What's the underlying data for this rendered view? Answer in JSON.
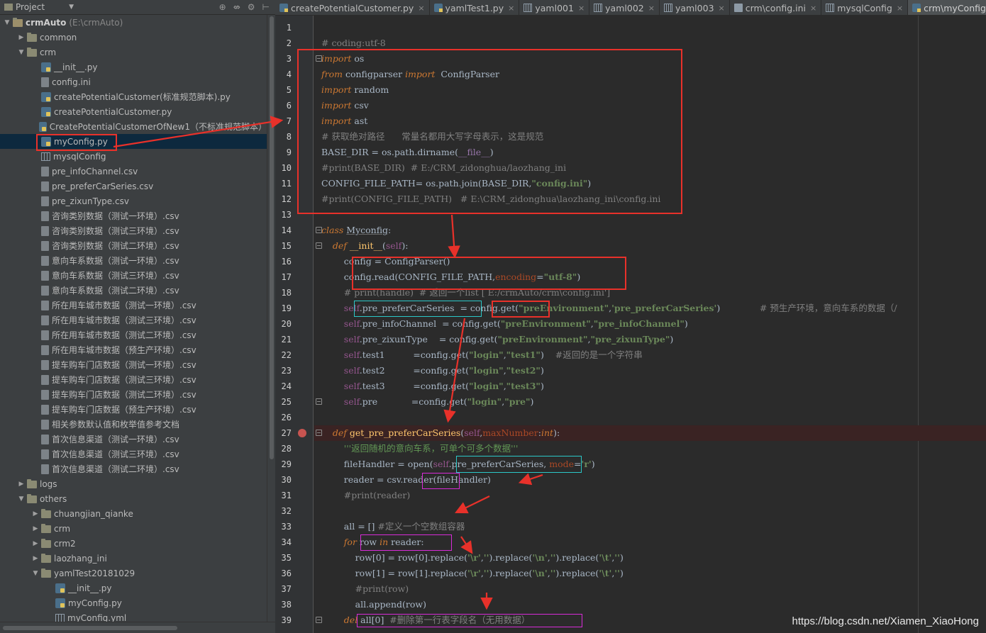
{
  "project_panel": {
    "title": "Project",
    "header_icons": [
      "globe-icon",
      "split-icon",
      "gear-icon",
      "collapse-icon"
    ]
  },
  "tree": [
    {
      "label": "crmAuto",
      "sub": "(E:\\crmAuto)",
      "icon": "folder",
      "arrow": "down",
      "depth": 0,
      "bold": true
    },
    {
      "label": "common",
      "icon": "folder",
      "arrow": "right",
      "depth": 1
    },
    {
      "label": "crm",
      "icon": "folder",
      "arrow": "down",
      "depth": 1
    },
    {
      "label": "__init__.py",
      "icon": "py",
      "depth": 2
    },
    {
      "label": "config.ini",
      "icon": "file",
      "depth": 2
    },
    {
      "label": "createPotentialCustomer(标准规范脚本).py",
      "icon": "py",
      "depth": 2
    },
    {
      "label": "createPotentialCustomer.py",
      "icon": "py",
      "depth": 2
    },
    {
      "label": "CreatePotentialCustomerOfNew1（不标准规范脚本）",
      "icon": "py",
      "depth": 2
    },
    {
      "label": "myConfig.py",
      "icon": "py",
      "depth": 2,
      "selected": true
    },
    {
      "label": "mysqlConfig",
      "icon": "grid",
      "depth": 2
    },
    {
      "label": "pre_infoChannel.csv",
      "icon": "file",
      "depth": 2
    },
    {
      "label": "pre_preferCarSeries.csv",
      "icon": "file",
      "depth": 2
    },
    {
      "label": "pre_zixunType.csv",
      "icon": "file",
      "depth": 2
    },
    {
      "label": "咨询类别数据（测试一环境）.csv",
      "icon": "file",
      "depth": 2
    },
    {
      "label": "咨询类别数据（测试三环境）.csv",
      "icon": "file",
      "depth": 2
    },
    {
      "label": "咨询类别数据（测试二环境）.csv",
      "icon": "file",
      "depth": 2
    },
    {
      "label": "意向车系数据（测试一环境）.csv",
      "icon": "file",
      "depth": 2
    },
    {
      "label": "意向车系数据（测试三环境）.csv",
      "icon": "file",
      "depth": 2
    },
    {
      "label": "意向车系数据（测试二环境）.csv",
      "icon": "file",
      "depth": 2
    },
    {
      "label": "所在用车城市数据（测试一环境）.csv",
      "icon": "file",
      "depth": 2
    },
    {
      "label": "所在用车城市数据（测试三环境）.csv",
      "icon": "file",
      "depth": 2
    },
    {
      "label": "所在用车城市数据（测试二环境）.csv",
      "icon": "file",
      "depth": 2
    },
    {
      "label": "所在用车城市数据（预生产环境）.csv",
      "icon": "file",
      "depth": 2
    },
    {
      "label": "提车购车门店数据（测试一环境）.csv",
      "icon": "file",
      "depth": 2
    },
    {
      "label": "提车购车门店数据（测试三环境）.csv",
      "icon": "file",
      "depth": 2
    },
    {
      "label": "提车购车门店数据（测试二环境）.csv",
      "icon": "file",
      "depth": 2
    },
    {
      "label": "提车购车门店数据（预生产环境）.csv",
      "icon": "file",
      "depth": 2
    },
    {
      "label": "相关参数默认值和枚举值参考文档",
      "icon": "file",
      "depth": 2
    },
    {
      "label": "首次信息渠道（测试一环境）.csv",
      "icon": "file",
      "depth": 2
    },
    {
      "label": "首次信息渠道（测试三环境）.csv",
      "icon": "file",
      "depth": 2
    },
    {
      "label": "首次信息渠道（测试二环境）.csv",
      "icon": "file",
      "depth": 2
    },
    {
      "label": "logs",
      "icon": "folder",
      "arrow": "right",
      "depth": 1
    },
    {
      "label": "others",
      "icon": "folder",
      "arrow": "down",
      "depth": 1
    },
    {
      "label": "chuangjian_qianke",
      "icon": "folder",
      "arrow": "right",
      "depth": 2
    },
    {
      "label": "crm",
      "icon": "folder",
      "arrow": "right",
      "depth": 2
    },
    {
      "label": "crm2",
      "icon": "folder",
      "arrow": "right",
      "depth": 2
    },
    {
      "label": "laozhang_ini",
      "icon": "folder",
      "arrow": "right",
      "depth": 2
    },
    {
      "label": "yamlTest20181029",
      "icon": "folder",
      "arrow": "down",
      "depth": 2
    },
    {
      "label": "__init__.py",
      "icon": "py",
      "depth": 3
    },
    {
      "label": "myConfig.py",
      "icon": "py",
      "depth": 3
    },
    {
      "label": "myConfig.yml",
      "icon": "grid",
      "depth": 3
    }
  ],
  "tabs": [
    {
      "label": "createPotentialCustomer.py",
      "icon": "py"
    },
    {
      "label": "yamlTest1.py",
      "icon": "py"
    },
    {
      "label": "yaml001",
      "icon": "grid"
    },
    {
      "label": "yaml002",
      "icon": "grid"
    },
    {
      "label": "yaml003",
      "icon": "grid"
    },
    {
      "label": "crm\\config.ini",
      "icon": "ini"
    },
    {
      "label": "mysqlConfig",
      "icon": "grid"
    },
    {
      "label": "crm\\myConfig.py",
      "icon": "py",
      "active": true
    }
  ],
  "code": [
    [],
    [
      [
        "cm",
        "# coding:utf-8"
      ]
    ],
    [
      [
        "kw",
        "import"
      ],
      [
        "t",
        " os"
      ]
    ],
    [
      [
        "kw",
        "from"
      ],
      [
        "t",
        " configparser "
      ],
      [
        "kw",
        "import"
      ],
      [
        "t",
        "  ConfigParser"
      ]
    ],
    [
      [
        "kw",
        "import"
      ],
      [
        "t",
        " random"
      ]
    ],
    [
      [
        "kw",
        "import"
      ],
      [
        "t",
        " csv"
      ]
    ],
    [
      [
        "kw",
        "import"
      ],
      [
        "t",
        " ast"
      ]
    ],
    [
      [
        "cm",
        "# 获取绝对路径      常量名都用大写字母表示，这是规范"
      ]
    ],
    [
      [
        "t",
        "BASE_DIR = os.path.dirname("
      ],
      [
        "cn",
        "__file__"
      ],
      [
        "t",
        ")"
      ]
    ],
    [
      [
        "cm",
        "#print(BASE_DIR)  # E:/CRM_zidonghua/laozhang_ini"
      ]
    ],
    [
      [
        "t",
        "CONFIG_FILE_PATH= os.path.join(BASE_DIR,"
      ],
      [
        "st",
        "\"config.ini\""
      ],
      [
        "t",
        ")"
      ]
    ],
    [
      [
        "cm",
        "#print(CONFIG_FILE_PATH)   # E:\\CRM_zidonghua\\laozhang_ini\\config.ini"
      ]
    ],
    [],
    [
      [
        "kw",
        "class "
      ],
      [
        "ul",
        "Myconfig"
      ],
      [
        "t",
        ":"
      ]
    ],
    [
      [
        "t",
        "    "
      ],
      [
        "kw",
        "def "
      ],
      [
        "fn",
        "__init__"
      ],
      [
        "t",
        "("
      ],
      [
        "sf",
        "self"
      ],
      [
        "t",
        "):"
      ]
    ],
    [
      [
        "t",
        "        config = ConfigParser()"
      ]
    ],
    [
      [
        "t",
        "        config.read(CONFIG_FILE_PATH,"
      ],
      [
        "pr",
        "encoding"
      ],
      [
        "t",
        "="
      ],
      [
        "st",
        "\"utf-8\""
      ],
      [
        "t",
        ")"
      ]
    ],
    [
      [
        "cm",
        "        # print(handle)  # 返回一个list [ E:/crmAuto/crm\\config.ini']"
      ]
    ],
    [
      [
        "t",
        "        "
      ],
      [
        "sf",
        "self"
      ],
      [
        "t",
        ".pre_preferCarSeries  = config.get("
      ],
      [
        "st",
        "\"preEnvironment\""
      ],
      [
        "t",
        ","
      ],
      [
        "st",
        "'pre_preferCarSeries'"
      ],
      [
        "t",
        ")"
      ],
      [
        "cm",
        "              # 预生产环境，意向车系的数据（/"
      ]
    ],
    [
      [
        "t",
        "        "
      ],
      [
        "sf",
        "self"
      ],
      [
        "t",
        ".pre_infoChannel  = config.get("
      ],
      [
        "st",
        "\"preEnvironment\""
      ],
      [
        "t",
        ","
      ],
      [
        "st",
        "\"pre_infoChannel\""
      ],
      [
        "t",
        ")"
      ]
    ],
    [
      [
        "t",
        "        "
      ],
      [
        "sf",
        "self"
      ],
      [
        "t",
        ".pre_zixunType    = config.get("
      ],
      [
        "st",
        "\"preEnvironment\""
      ],
      [
        "t",
        ","
      ],
      [
        "st",
        "\"pre_zixunType\""
      ],
      [
        "t",
        ")"
      ]
    ],
    [
      [
        "t",
        "        "
      ],
      [
        "sf",
        "self"
      ],
      [
        "t",
        ".test1          =config.get("
      ],
      [
        "st",
        "\"login\""
      ],
      [
        "t",
        ","
      ],
      [
        "st",
        "\"test1\""
      ],
      [
        "t",
        ")    "
      ],
      [
        "cm",
        "#返回的是一个字符串"
      ]
    ],
    [
      [
        "t",
        "        "
      ],
      [
        "sf",
        "self"
      ],
      [
        "t",
        ".test2          =config.get("
      ],
      [
        "st",
        "\"login\""
      ],
      [
        "t",
        ","
      ],
      [
        "st",
        "\"test2\""
      ],
      [
        "t",
        ")"
      ]
    ],
    [
      [
        "t",
        "        "
      ],
      [
        "sf",
        "self"
      ],
      [
        "t",
        ".test3          =config.get("
      ],
      [
        "st",
        "\"login\""
      ],
      [
        "t",
        ","
      ],
      [
        "st",
        "\"test3\""
      ],
      [
        "t",
        ")"
      ]
    ],
    [
      [
        "t",
        "        "
      ],
      [
        "sf",
        "self"
      ],
      [
        "t",
        ".pre            =config.get("
      ],
      [
        "st",
        "\"login\""
      ],
      [
        "t",
        ","
      ],
      [
        "st",
        "\"pre\""
      ],
      [
        "t",
        ")"
      ]
    ],
    [],
    [
      [
        "t",
        "    "
      ],
      [
        "kw",
        "def "
      ],
      [
        "fn",
        "get_pre_preferCarSeries"
      ],
      [
        "t",
        "("
      ],
      [
        "sf",
        "self"
      ],
      [
        "t",
        ","
      ],
      [
        "pr",
        "maxNumber"
      ],
      [
        "t",
        ":"
      ],
      [
        "kw",
        "int"
      ],
      [
        "t",
        "):"
      ]
    ],
    [
      [
        "dc",
        "        '''返回随机的意向车系，可单个可多个数据'''"
      ]
    ],
    [
      [
        "t",
        "        fileHandler = open("
      ],
      [
        "sf",
        "self"
      ],
      [
        "t",
        ".pre_preferCarSeries, "
      ],
      [
        "pr",
        "mode"
      ],
      [
        "t",
        "="
      ],
      [
        "st",
        "'r'"
      ],
      [
        "t",
        ")"
      ]
    ],
    [
      [
        "t",
        "        reader = csv.reader(fileHandler)"
      ]
    ],
    [
      [
        "cm",
        "        #print(reader)"
      ]
    ],
    [],
    [
      [
        "t",
        "        all = [] "
      ],
      [
        "cm",
        "#定义一个空数组容器"
      ]
    ],
    [
      [
        "t",
        "        "
      ],
      [
        "kw",
        "for"
      ],
      [
        "t",
        " row "
      ],
      [
        "kw",
        "in"
      ],
      [
        "t",
        " reader:"
      ]
    ],
    [
      [
        "t",
        "            row[0] = row[0].replace("
      ],
      [
        "st",
        "'\\r'"
      ],
      [
        "t",
        ","
      ],
      [
        "st",
        "''"
      ],
      [
        "t",
        ").replace("
      ],
      [
        "st",
        "'\\n'"
      ],
      [
        "t",
        ","
      ],
      [
        "st",
        "''"
      ],
      [
        "t",
        ").replace("
      ],
      [
        "st",
        "'\\t'"
      ],
      [
        "t",
        ","
      ],
      [
        "st",
        "''"
      ],
      [
        "t",
        ")"
      ]
    ],
    [
      [
        "t",
        "            row[1] = row[1].replace("
      ],
      [
        "st",
        "'\\r'"
      ],
      [
        "t",
        ","
      ],
      [
        "st",
        "''"
      ],
      [
        "t",
        ").replace("
      ],
      [
        "st",
        "'\\n'"
      ],
      [
        "t",
        ","
      ],
      [
        "st",
        "''"
      ],
      [
        "t",
        ").replace("
      ],
      [
        "st",
        "'\\t'"
      ],
      [
        "t",
        ","
      ],
      [
        "st",
        "''"
      ],
      [
        "t",
        ")"
      ]
    ],
    [
      [
        "cm",
        "            #print(row)"
      ]
    ],
    [
      [
        "t",
        "            all.append(row)"
      ]
    ],
    [
      [
        "t",
        "        "
      ],
      [
        "kw",
        "del"
      ],
      [
        "t",
        " all[0]  "
      ],
      [
        "cm",
        "#删除第一行表字段名（无用数据）"
      ]
    ]
  ],
  "watermark": "https://blog.csdn.net/Xiamen_XiaoHong"
}
